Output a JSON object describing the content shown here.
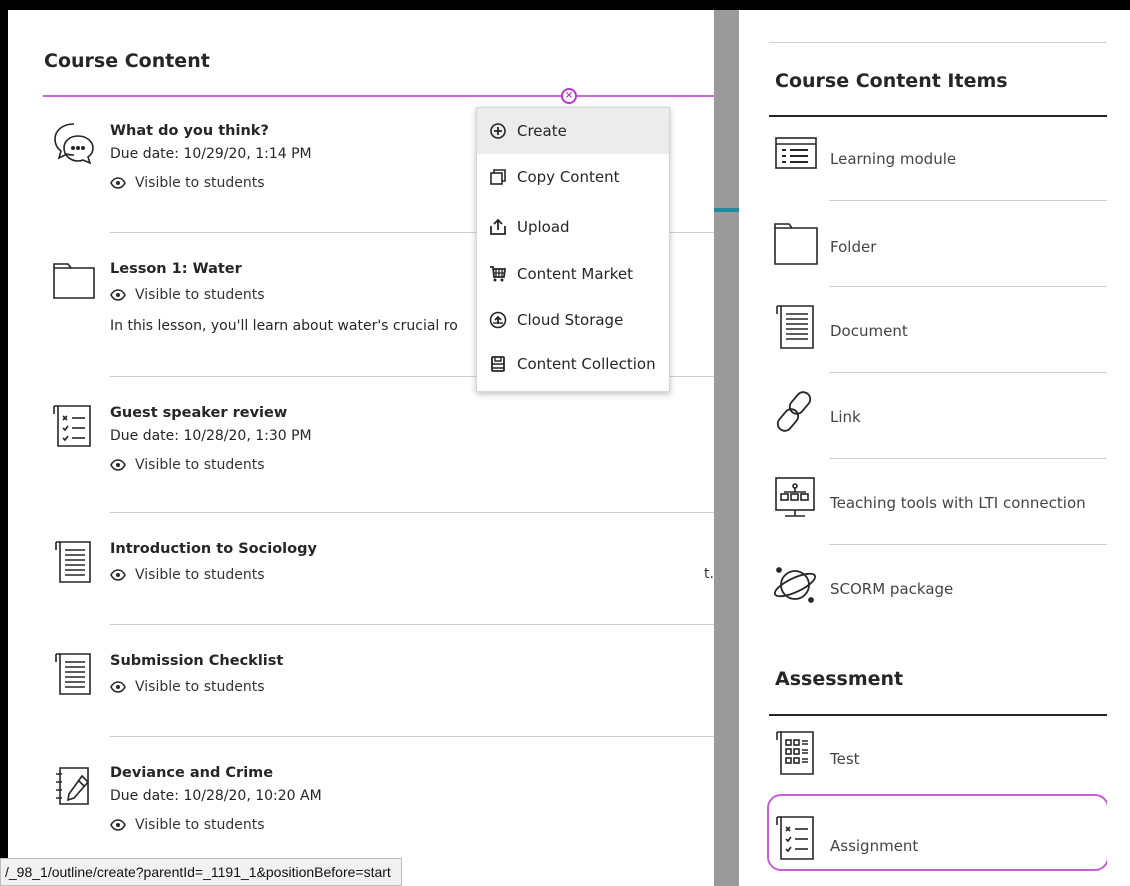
{
  "left_panel": {
    "title": "Course Content",
    "items": [
      {
        "name": "What do you think?",
        "due": "Due date: 10/29/20, 1:14 PM",
        "visibility": "Visible to students",
        "icon": "discussion-icon"
      },
      {
        "name": "Lesson 1: Water",
        "visibility": "Visible to students",
        "description": "In this lesson, you'll learn about water's crucial ro",
        "icon": "folder-icon"
      },
      {
        "name": "Guest speaker review",
        "due": "Due date: 10/28/20, 1:30 PM",
        "visibility": "Visible to students",
        "icon": "assignment-icon"
      },
      {
        "name": "Introduction to Sociology",
        "visibility": "Visible to students",
        "icon": "document-icon"
      },
      {
        "name": "Submission Checklist",
        "visibility": "Visible to students",
        "icon": "document-icon"
      },
      {
        "name": "Deviance and Crime",
        "due": "Due date: 10/28/20, 10:20 AM",
        "visibility": "Visible to students",
        "icon": "journal-icon"
      }
    ],
    "truncated_text": "t."
  },
  "menu": {
    "items": [
      {
        "label": "Create",
        "icon": "plus-circle-icon",
        "active": true
      },
      {
        "label": "Copy Content",
        "icon": "copy-icon"
      },
      {
        "label": "Upload",
        "icon": "upload-icon"
      },
      {
        "label": "Content Market",
        "icon": "cart-icon"
      },
      {
        "label": "Cloud Storage",
        "icon": "cloud-upload-icon"
      },
      {
        "label": "Content Collection",
        "icon": "collection-icon"
      }
    ]
  },
  "right_panel": {
    "section1_title": "Course Content Items",
    "section1_items": [
      {
        "label": "Learning module",
        "icon": "learning-module-icon"
      },
      {
        "label": "Folder",
        "icon": "folder-icon"
      },
      {
        "label": "Document",
        "icon": "document-icon"
      },
      {
        "label": "Link",
        "icon": "link-icon"
      },
      {
        "label": "Teaching tools with LTI connection",
        "icon": "lti-icon"
      },
      {
        "label": "SCORM package",
        "icon": "scorm-icon"
      }
    ],
    "section2_title": "Assessment",
    "section2_items": [
      {
        "label": "Test",
        "icon": "test-icon"
      },
      {
        "label": "Assignment",
        "icon": "assignment-icon",
        "highlighted": true
      }
    ]
  },
  "status_bar": {
    "url": "/_98_1/outline/create?parentId=_1191_1&positionBefore=start"
  },
  "colors": {
    "accent_purple": "#c55fd6",
    "teal": "#1e8a9a"
  }
}
